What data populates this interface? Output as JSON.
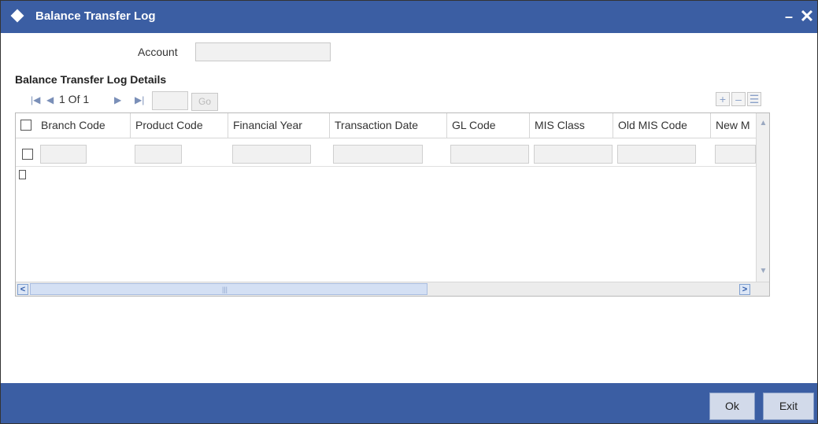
{
  "window": {
    "title": "Balance Transfer Log"
  },
  "account": {
    "label": "Account",
    "value": ""
  },
  "details": {
    "title": "Balance Transfer Log Details",
    "pager": {
      "text": "1 Of 1",
      "page_input": "",
      "go_label": "Go"
    },
    "columns": [
      "Branch Code",
      "Product Code",
      "Financial Year",
      "Transaction Date",
      "GL Code",
      "MIS Class",
      "Old MIS Code",
      "New M"
    ]
  },
  "footer": {
    "ok_label": "Ok",
    "exit_label": "Exit"
  },
  "colors": {
    "titlebar": "#3b5ea3",
    "footer": "#3b5ea3",
    "button": "#d2daea"
  }
}
